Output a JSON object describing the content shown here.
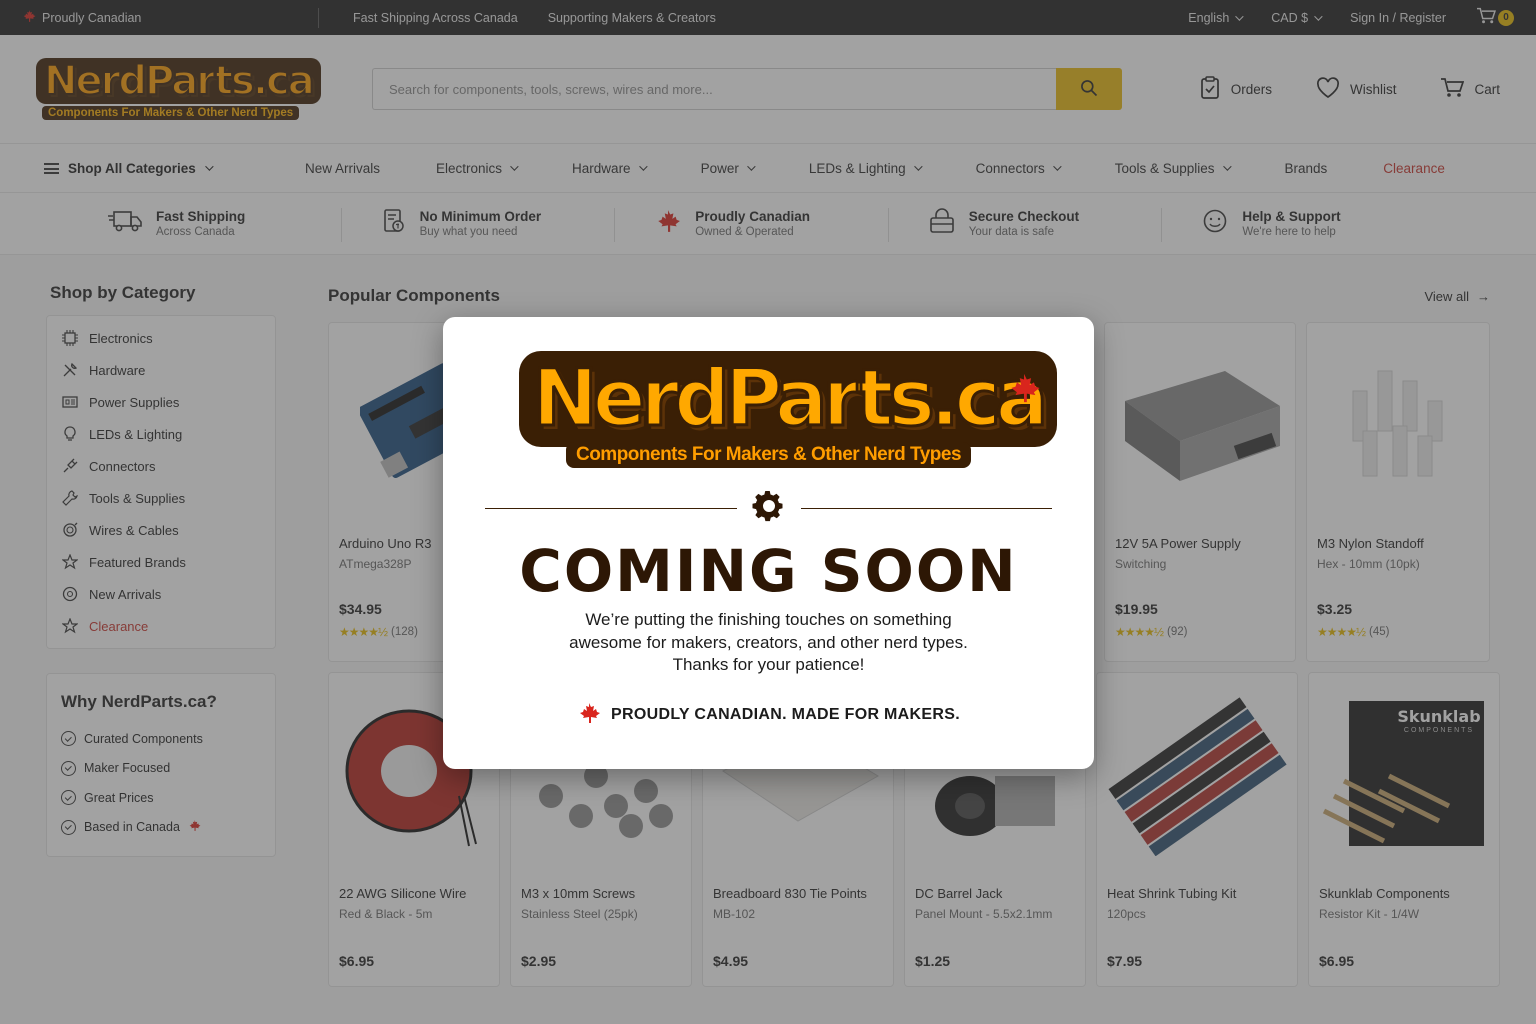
{
  "topbar": {
    "proudly": "Proudly Canadian",
    "shipping": "Fast Shipping Across Canada",
    "supporting": "Supporting Makers & Creators",
    "language": "English",
    "currency": "CAD $",
    "signin": "Sign In / Register",
    "cart_count": "0"
  },
  "header": {
    "logo_word": "NerdParts.ca",
    "logo_tagline": "Components For Makers & Other Nerd Types",
    "search_placeholder": "Search for components, tools, screws, wires and more...",
    "orders": "Orders",
    "wishlist": "Wishlist",
    "cart": "Cart"
  },
  "nav": {
    "shop_all": "Shop All Categories",
    "items": [
      "New Arrivals",
      "Electronics",
      "Hardware",
      "Power",
      "LEDs & Lighting",
      "Connectors",
      "Tools & Supplies",
      "Brands",
      "Clearance"
    ]
  },
  "features": [
    {
      "title": "Fast Shipping",
      "sub": "Across Canada",
      "icon": "truck-icon"
    },
    {
      "title": "No Minimum Order",
      "sub": "Buy what you need",
      "icon": "receipt-icon"
    },
    {
      "title": "Proudly Canadian",
      "sub": "Owned & Operated",
      "icon": "maple-leaf-icon"
    },
    {
      "title": "Secure Checkout",
      "sub": "Your data is safe",
      "icon": "lock-icon"
    },
    {
      "title": "Help & Support",
      "sub": "We're here to help",
      "icon": "support-icon"
    }
  ],
  "sidebar": {
    "title": "Shop by Category",
    "categories": [
      "Electronics",
      "Hardware",
      "Power Supplies",
      "LEDs & Lighting",
      "Connectors",
      "Tools & Supplies",
      "Wires & Cables",
      "Featured Brands",
      "New Arrivals",
      "Clearance"
    ],
    "why_title": "Why NerdParts.ca?",
    "why_items": [
      "Curated Components",
      "Maker Focused",
      "Great Prices",
      "Based in Canada"
    ]
  },
  "content": {
    "title": "Popular Components",
    "view_all": "View all",
    "row1": [
      {
        "name": "Arduino Uno R3",
        "sub": "ATmega328P",
        "price": "$34.95",
        "reviews": "(128)",
        "stars": 4.5
      },
      {
        "name": "",
        "sub": "",
        "price": "",
        "reviews": "",
        "stars": 0
      },
      {
        "name": "",
        "sub": "",
        "price": "",
        "reviews": "",
        "stars": 0
      },
      {
        "name": "",
        "sub": "",
        "price": "",
        "reviews": "",
        "stars": 0
      },
      {
        "name": "12V 5A Power Supply",
        "sub": "Switching",
        "price": "$19.95",
        "reviews": "(92)",
        "stars": 4.5
      },
      {
        "name": "M3 Nylon Standoff",
        "sub": "Hex - 10mm (10pk)",
        "price": "$3.25",
        "reviews": "(45)",
        "stars": 4.5
      }
    ],
    "row2": [
      {
        "name": "22 AWG Silicone Wire",
        "sub": "Red & Black - 5m",
        "price": "$6.95"
      },
      {
        "name": "M3 x 10mm Screws",
        "sub": "Stainless Steel (25pk)",
        "price": "$2.95"
      },
      {
        "name": "Breadboard 830 Tie Points",
        "sub": "MB-102",
        "price": "$4.95"
      },
      {
        "name": "DC Barrel Jack",
        "sub": "Panel Mount - 5.5x2.1mm",
        "price": "$1.25"
      },
      {
        "name": "Heat Shrink Tubing Kit",
        "sub": "120pcs",
        "price": "$7.95"
      },
      {
        "name": "Skunklab Components",
        "sub": "Resistor Kit - 1/4W",
        "price": "$6.95",
        "box_brand": "Skunklab",
        "box_sub": "COMPONENTS"
      }
    ]
  },
  "modal": {
    "logo_word": "NerdParts.ca",
    "logo_tagline": "Components For Makers & Other Nerd Types",
    "heading": "COMING SOON",
    "line1": "We’re putting the finishing touches on something",
    "line2": "awesome for makers, creators, and other nerd types.",
    "line3": "Thanks for your patience!",
    "proud": "PROUDLY CANADIAN. MADE FOR MAKERS."
  },
  "colors": {
    "accent": "#e9b80f",
    "brand_orange": "#ff9d00",
    "brand_brown": "#3a1f05",
    "clearance_red": "#c8332b",
    "maple_red": "#d9251d"
  }
}
